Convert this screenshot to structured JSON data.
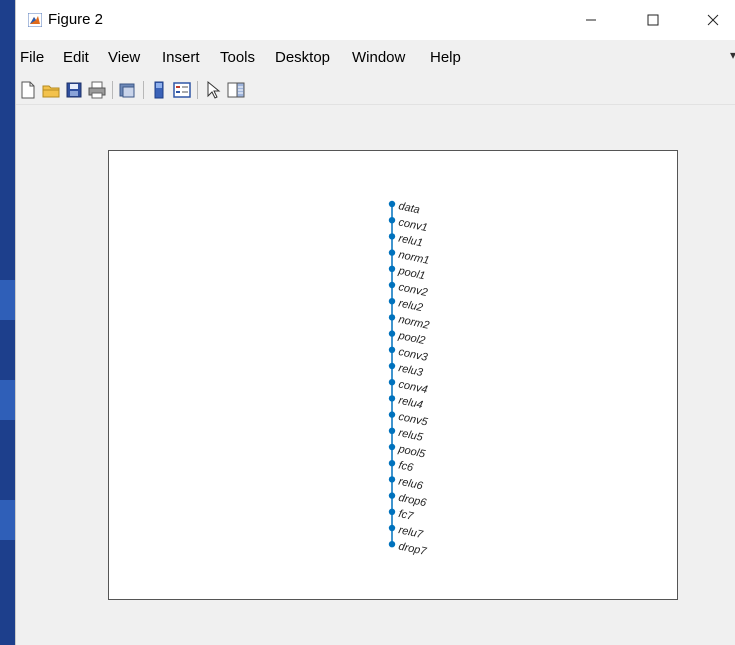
{
  "window": {
    "title": "Figure 2",
    "controls": [
      "minimize",
      "maximize",
      "close"
    ]
  },
  "menubar": {
    "items": [
      "File",
      "Edit",
      "View",
      "Insert",
      "Tools",
      "Desktop",
      "Window",
      "Help"
    ]
  },
  "toolbar": {
    "icons": [
      "new-figure-icon",
      "open-file-icon",
      "save-icon",
      "print-icon",
      "link-plot-icon",
      "colorbar-icon",
      "legend-icon",
      "pointer-icon",
      "property-inspector-icon"
    ]
  },
  "graph": {
    "marker_color": "#0072BD",
    "nodes": [
      "data",
      "conv1",
      "relu1",
      "norm1",
      "pool1",
      "conv2",
      "relu2",
      "norm2",
      "pool2",
      "conv3",
      "relu3",
      "conv4",
      "relu4",
      "conv5",
      "relu5",
      "pool5",
      "fc6",
      "relu6",
      "drop6",
      "fc7",
      "relu7",
      "drop7"
    ]
  }
}
